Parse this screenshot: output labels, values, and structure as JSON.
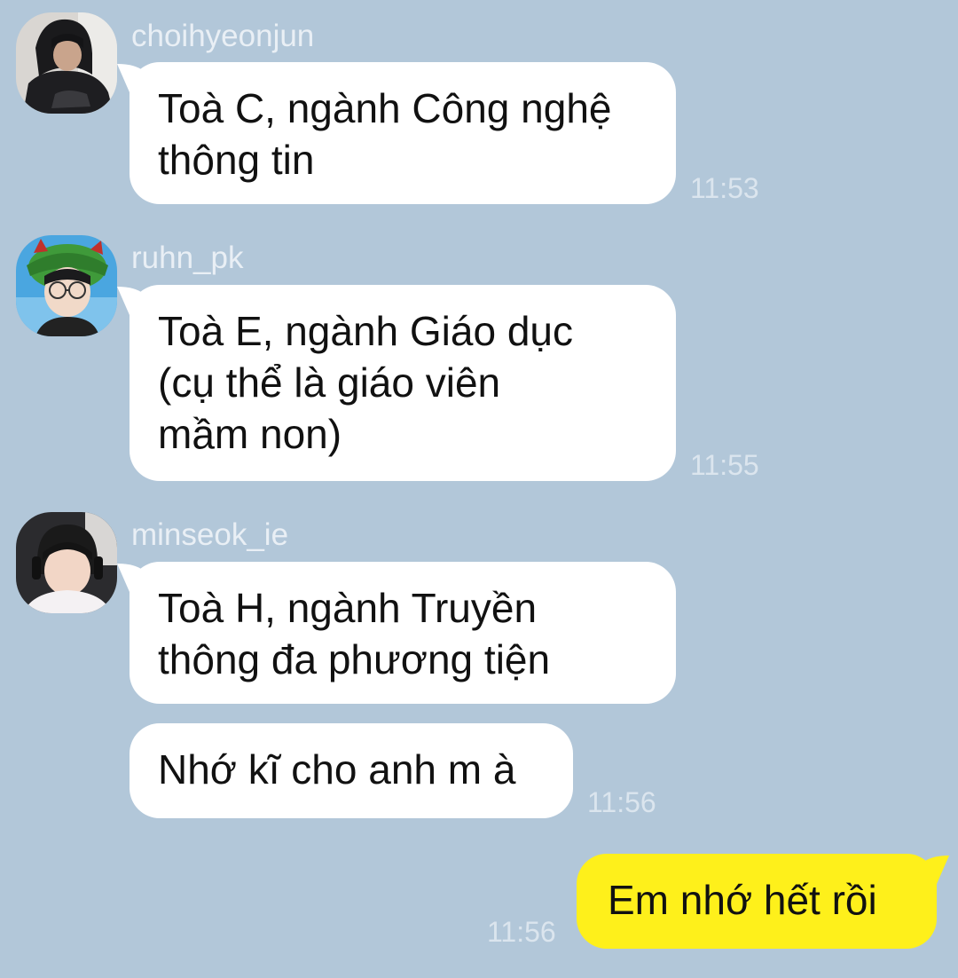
{
  "messages": [
    {
      "sender": "choihyeonjun",
      "lines": [
        "Toà C, ngành Công nghệ",
        "thông tin"
      ],
      "time": "11:53"
    },
    {
      "sender": "ruhn_pk",
      "lines": [
        "Toà E, ngành Giáo dục",
        "(cụ thể là giáo viên",
        "mầm non)"
      ],
      "time": "11:55"
    },
    {
      "sender": "minseok_ie",
      "lines": [
        "Toà H, ngành Truyền",
        "thông đa phương tiện"
      ],
      "time": ""
    },
    {
      "sender": "",
      "lines": [
        "Nhớ kĩ cho anh m à"
      ],
      "time": "11:56"
    }
  ],
  "my_message": {
    "text": "Em nhớ hết rồi",
    "time": "11:56"
  },
  "colors": {
    "background": "#b2c7d9",
    "incoming_bubble": "#ffffff",
    "outgoing_bubble": "#fef01b",
    "meta_text": "#e9eff5"
  },
  "icons": {
    "avatar_1": "avatar-photo-hoodie",
    "avatar_2": "avatar-photo-green-hat",
    "avatar_3": "avatar-photo-headset"
  }
}
